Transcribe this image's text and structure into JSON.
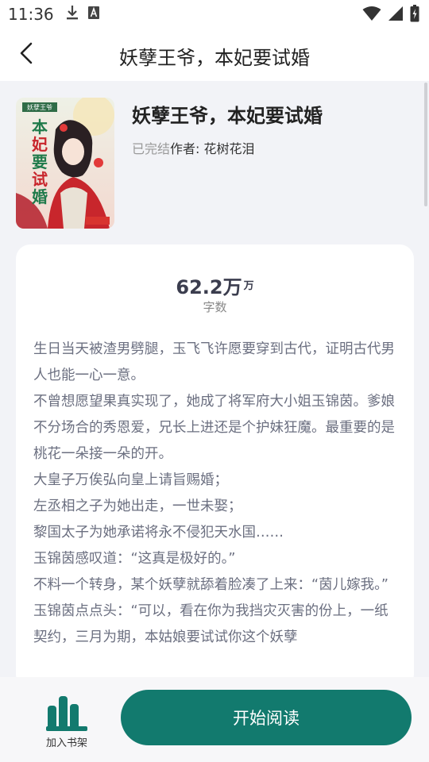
{
  "status_bar": {
    "time": "11:36",
    "icons": [
      "download-icon",
      "font-icon",
      "wifi-icon",
      "signal-icon",
      "battery-icon"
    ]
  },
  "header": {
    "title": "妖孽王爷，本妃要试婚"
  },
  "book": {
    "title": "妖孽王爷，本妃要试婚",
    "status": "已完结",
    "author": "作者: 花树花泪",
    "cover_lettering": [
      "妖孽王爷",
      "本妃要试婚"
    ]
  },
  "stats": {
    "word_count": "62.2万",
    "word_count_unit": "万",
    "word_count_label": "字数"
  },
  "intro": {
    "paragraphs": [
      "生日当天被渣男劈腿，玉飞飞许愿要穿到古代，证明古代男人也能一心一意。",
      "不曾想愿望果真实现了，她成了将军府大小姐玉锦茵。爹娘不分场合的秀恩爱，兄长上进还是个护妹狂魔。最重要的是桃花一朵接一朵的开。",
      "大皇子万俟弘向皇上请旨赐婚；",
      "左丞相之子为她出走，一世未娶；",
      "黎国太子为她承诺将永不侵犯天水国……",
      "玉锦茵感叹道：“这真是极好的。”",
      "不料一个转身，某个妖孽就舔着脸凑了上来：“茵儿嫁我。”",
      "玉锦茵点点头：“可以，看在你为我挡灾灭害的份上，一纸契约，三月为期，本姑娘要试试你这个妖孽"
    ]
  },
  "bottom_bar": {
    "shelf_label": "加入书架",
    "read_label": "开始阅读"
  },
  "colors": {
    "accent": "#127a6e",
    "background": "#f2f3f7",
    "card": "#ffffff",
    "intro_text": "#6b6f80"
  }
}
